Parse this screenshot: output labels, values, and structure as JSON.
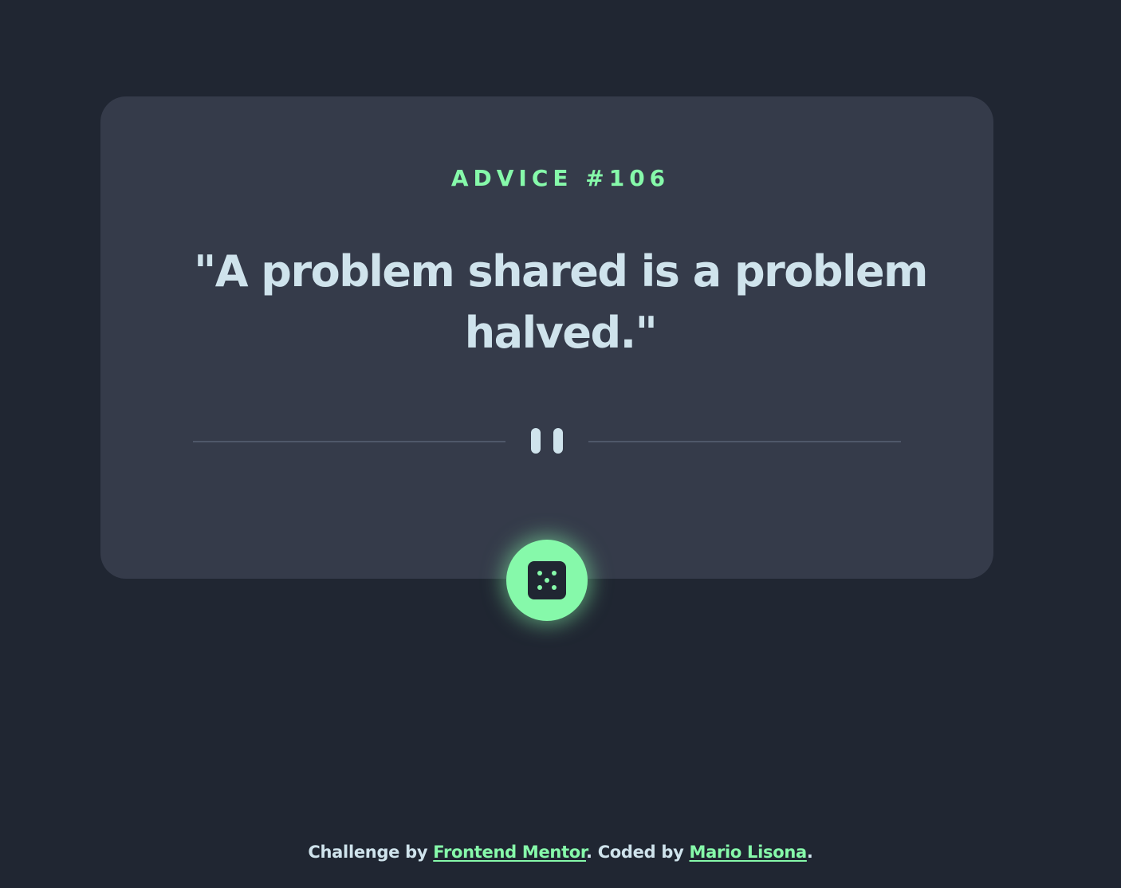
{
  "card": {
    "advice_label": "ADVICE #106",
    "quote": "\"A problem shared is a problem halved.\"",
    "divider_icon": "pause-icon",
    "dice_icon": "dice-icon"
  },
  "footer": {
    "prefix": "Challenge by ",
    "link1": "Frontend Mentor",
    "middle": ". Coded by ",
    "link2": "Mario Lisona",
    "suffix": "."
  },
  "colors": {
    "background": "#202632",
    "card": "#353b4a",
    "accent": "#86f9aa",
    "text": "#cfe3ec",
    "divider": "#4f5869"
  }
}
